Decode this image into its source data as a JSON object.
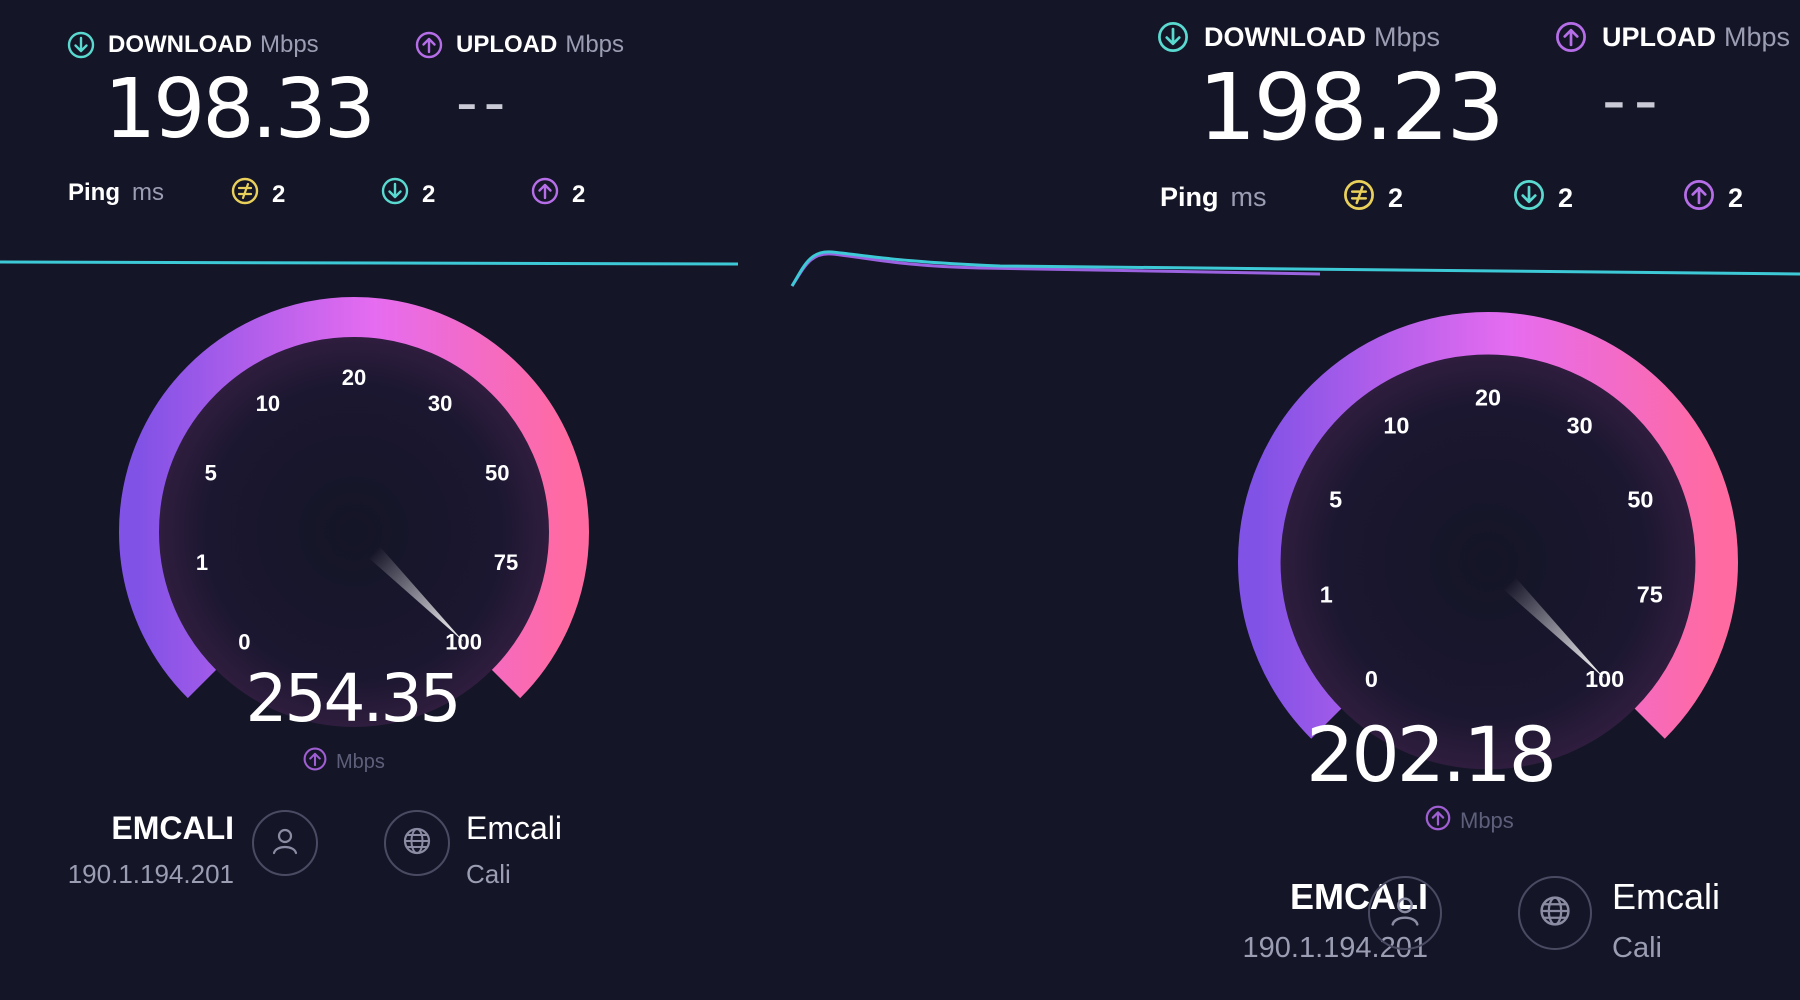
{
  "colors": {
    "background": "#141526",
    "download": "#59d9cf",
    "upload": "#b66ee8",
    "ping": "#e9d05a",
    "gauge_start": "#8152e6",
    "gauge_end": "#ff6aa0",
    "graph_line": "#3ec9d6"
  },
  "left": {
    "download": {
      "label": "DOWNLOAD",
      "unit": "Mbps",
      "value": "198.33",
      "icon": "download-arrow-icon"
    },
    "upload": {
      "label": "UPLOAD",
      "unit": "Mbps",
      "value": "--",
      "icon": "upload-arrow-icon"
    },
    "ping": {
      "label": "Ping",
      "unit": "ms",
      "idle": "2",
      "download": "2",
      "upload": "2"
    },
    "gauge": {
      "ticks": [
        "0",
        "1",
        "5",
        "10",
        "20",
        "30",
        "50",
        "75",
        "100"
      ],
      "value": "254.35",
      "unit": "Mbps",
      "needle_position": 1.0
    },
    "isp": {
      "name": "EMCALI",
      "ip": "190.1.194.201",
      "icon": "user-icon"
    },
    "server": {
      "name": "Emcali",
      "location": "Cali",
      "icon": "globe-icon"
    }
  },
  "right": {
    "download": {
      "label": "DOWNLOAD",
      "unit": "Mbps",
      "value": "198.23",
      "icon": "download-arrow-icon"
    },
    "upload": {
      "label": "UPLOAD",
      "unit": "Mbps",
      "value": "--",
      "icon": "upload-arrow-icon"
    },
    "ping": {
      "label": "Ping",
      "unit": "ms",
      "idle": "2",
      "download": "2",
      "upload": "2"
    },
    "gauge": {
      "ticks": [
        "0",
        "1",
        "5",
        "10",
        "20",
        "30",
        "50",
        "75",
        "100"
      ],
      "value": "202.18",
      "unit": "Mbps",
      "needle_position": 1.0
    },
    "isp": {
      "name": "EMCALI",
      "ip": "190.1.194.201",
      "icon": "user-icon"
    },
    "server": {
      "name": "Emcali",
      "location": "Cali",
      "icon": "globe-icon"
    }
  }
}
